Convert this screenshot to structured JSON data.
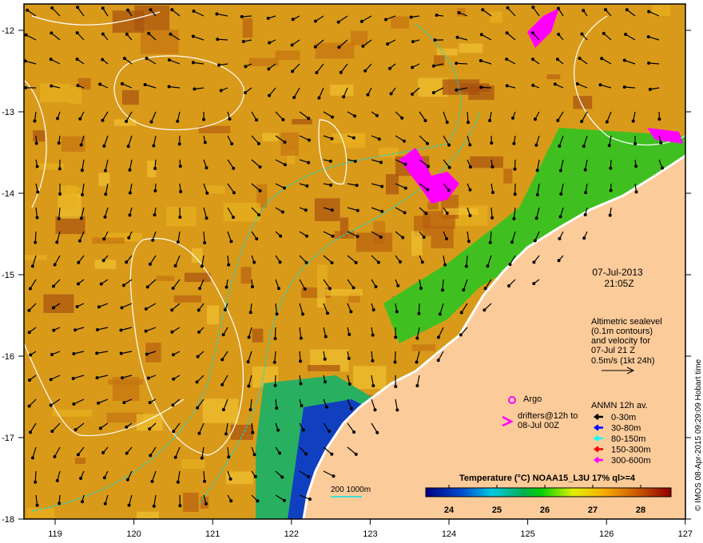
{
  "map": {
    "lon_ticks": [
      "119",
      "120",
      "121",
      "122",
      "123",
      "124",
      "125",
      "126",
      "127"
    ],
    "lat_ticks": [
      "-12",
      "-13",
      "-14",
      "-15",
      "-16",
      "-17",
      "-18"
    ],
    "date": "07-Jul-2013",
    "time": "21:05Z",
    "altimetry_note": [
      "Altimetric sealevel",
      "(0.1m contours)",
      "and velocity for",
      "07-Jul 21 Z",
      "0.5m/s (1kt 24h)"
    ],
    "argo_label": "Argo",
    "drifters_label": [
      "drifters@12h to",
      "08-Jul 00Z"
    ],
    "anmn_title": "ANMN 12h av.",
    "anmn_legend": [
      {
        "label": "0-30m",
        "color": "#000000"
      },
      {
        "label": "30-80m",
        "color": "#0000ff"
      },
      {
        "label": "80-150m",
        "color": "#00ffff"
      },
      {
        "label": "150-300m",
        "color": "#ff0000"
      },
      {
        "label": "300-600m",
        "color": "#ff00ff"
      }
    ],
    "depth_contours_label": "200  1000m",
    "colorbar_title": "Temperature (°C) NOAA15_L3U 17% ql>=4",
    "colorbar_ticks": [
      "24",
      "25",
      "26",
      "27",
      "28"
    ],
    "credit": "© IMOS 08-Apr-2015 09:29:09 Hobart time",
    "colors": {
      "land": "#fccb9a",
      "contour": "#ffffff",
      "isobath": "#00e5e5",
      "drifter": "#ff00ff"
    }
  }
}
